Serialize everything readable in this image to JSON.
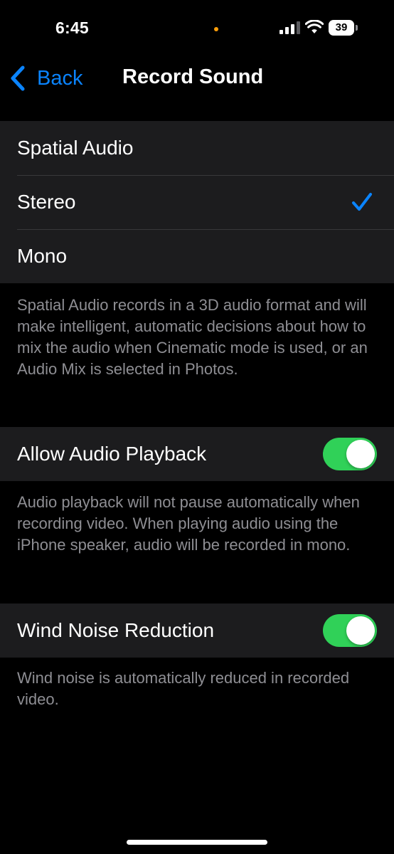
{
  "status_bar": {
    "time": "6:45",
    "battery_level": "39",
    "icons": [
      "signal-icon",
      "wifi-icon",
      "battery-icon"
    ],
    "privacy_dot_color": "#ff9f0a"
  },
  "nav": {
    "back_label": "Back",
    "title": "Record Sound"
  },
  "format_group": {
    "options": [
      {
        "label": "Spatial Audio",
        "selected": false
      },
      {
        "label": "Stereo",
        "selected": true
      },
      {
        "label": "Mono",
        "selected": false
      }
    ],
    "footer": "Spatial Audio records in a 3D audio format and will make intelligent, automatic decisions about how to mix the audio when Cinematic mode is used, or an Audio Mix is selected in Photos."
  },
  "audio_playback": {
    "label": "Allow Audio Playback",
    "enabled": true,
    "footer": "Audio playback will not pause automatically when recording video. When playing audio using the iPhone speaker, audio will be recorded in mono."
  },
  "wind_noise": {
    "label": "Wind Noise Reduction",
    "enabled": true,
    "footer": "Wind noise is automatically reduced in recorded video."
  },
  "colors": {
    "accent": "#0a84ff",
    "toggle_on": "#30d158",
    "background": "#000000",
    "group_background": "#1c1c1e",
    "secondary_text": "#8e8e93"
  }
}
